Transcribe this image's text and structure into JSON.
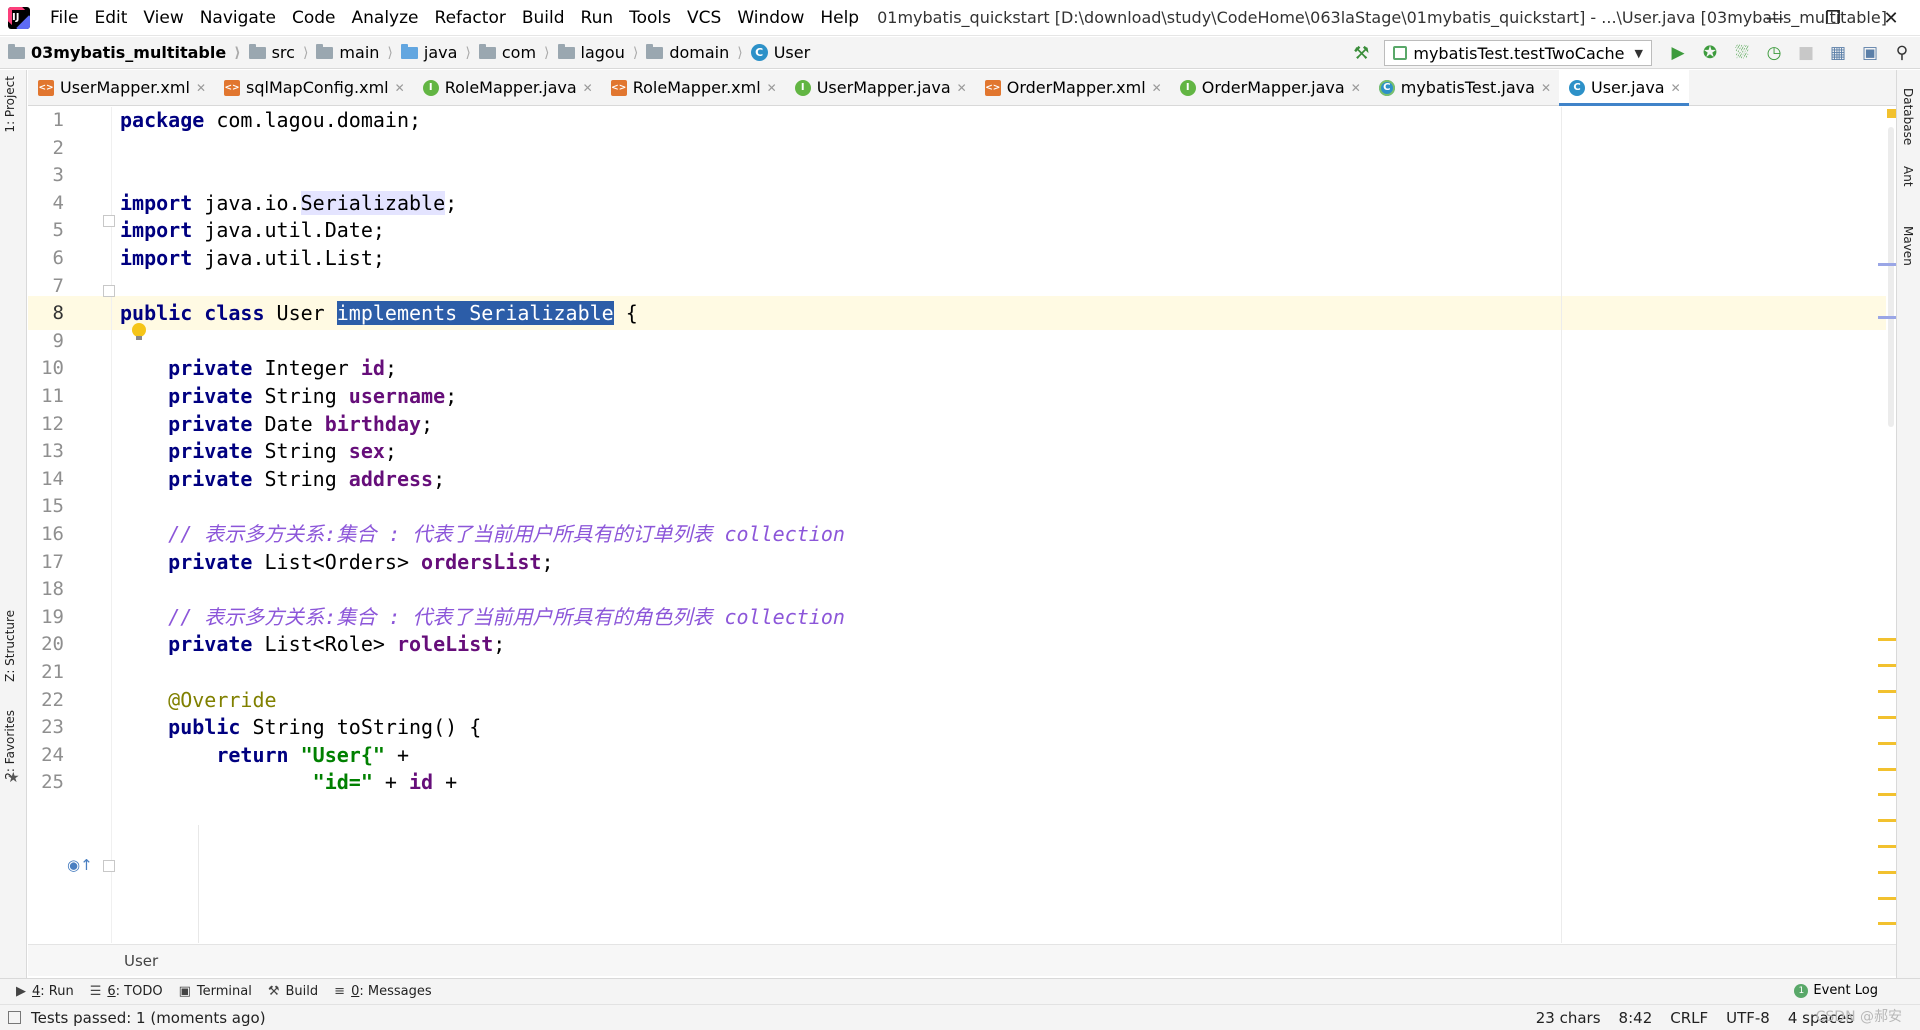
{
  "menubar": {
    "items": [
      "File",
      "Edit",
      "View",
      "Navigate",
      "Code",
      "Analyze",
      "Refactor",
      "Build",
      "Run",
      "Tools",
      "VCS",
      "Window",
      "Help"
    ],
    "window_title": "01mybatis_quickstart [D:\\download\\study\\CodeHome\\063laStage\\01mybatis_quickstart] - ...\\User.java [03mybatis_multitable]"
  },
  "navbar": {
    "project": "03mybatis_multitable",
    "crumbs": [
      "src",
      "main",
      "java",
      "com",
      "lagou",
      "domain",
      "User"
    ],
    "run_config": "mybatisTest.testTwoCache"
  },
  "left_tools": {
    "project": "1: Project",
    "structure": "Z: Structure",
    "favorites": "2: Favorites"
  },
  "right_tools": {
    "database": "Database",
    "ant": "Ant",
    "maven": "Maven"
  },
  "tabs": [
    {
      "label": "UserMapper.xml",
      "type": "xml"
    },
    {
      "label": "sqlMapConfig.xml",
      "type": "xml"
    },
    {
      "label": "RoleMapper.java",
      "type": "iface"
    },
    {
      "label": "RoleMapper.xml",
      "type": "xml"
    },
    {
      "label": "UserMapper.java",
      "type": "iface"
    },
    {
      "label": "OrderMapper.xml",
      "type": "xml"
    },
    {
      "label": "OrderMapper.java",
      "type": "iface"
    },
    {
      "label": "mybatisTest.java",
      "type": "test"
    },
    {
      "label": "User.java",
      "type": "cls",
      "active": true
    }
  ],
  "editor": {
    "current_line": 8,
    "lines": [
      {
        "n": "1",
        "code": [
          [
            "kw",
            "package"
          ],
          [
            "",
            " com.lagou.domain;"
          ]
        ]
      },
      {
        "n": "2",
        "code": []
      },
      {
        "n": "3",
        "code": []
      },
      {
        "n": "4",
        "code": [
          [
            "kw",
            "import"
          ],
          [
            "",
            " java.io."
          ],
          [
            "hl",
            "Serializable"
          ],
          [
            "",
            ";"
          ]
        ]
      },
      {
        "n": "5",
        "code": [
          [
            "kw",
            "import"
          ],
          [
            "",
            " java.util.Date;"
          ]
        ]
      },
      {
        "n": "6",
        "code": [
          [
            "kw",
            "import"
          ],
          [
            "",
            " java.util.List;"
          ]
        ]
      },
      {
        "n": "7",
        "code": []
      },
      {
        "n": "8",
        "code": [
          [
            "kw",
            "public class"
          ],
          [
            "",
            " User "
          ],
          [
            "sel",
            "implements Serializable"
          ],
          [
            "",
            " {"
          ]
        ]
      },
      {
        "n": "9",
        "code": []
      },
      {
        "n": "10",
        "code": [
          [
            "",
            "    "
          ],
          [
            "kw",
            "private"
          ],
          [
            "",
            " Integer "
          ],
          [
            "fld",
            "id"
          ],
          [
            "",
            ";"
          ]
        ]
      },
      {
        "n": "11",
        "code": [
          [
            "",
            "    "
          ],
          [
            "kw",
            "private"
          ],
          [
            "",
            " String "
          ],
          [
            "fld",
            "username"
          ],
          [
            "",
            ";"
          ]
        ]
      },
      {
        "n": "12",
        "code": [
          [
            "",
            "    "
          ],
          [
            "kw",
            "private"
          ],
          [
            "",
            " Date "
          ],
          [
            "fld",
            "birthday"
          ],
          [
            "",
            ";"
          ]
        ]
      },
      {
        "n": "13",
        "code": [
          [
            "",
            "    "
          ],
          [
            "kw",
            "private"
          ],
          [
            "",
            " String "
          ],
          [
            "fld",
            "sex"
          ],
          [
            "",
            ";"
          ]
        ]
      },
      {
        "n": "14",
        "code": [
          [
            "",
            "    "
          ],
          [
            "kw",
            "private"
          ],
          [
            "",
            " String "
          ],
          [
            "fld",
            "address"
          ],
          [
            "",
            ";"
          ]
        ]
      },
      {
        "n": "15",
        "code": []
      },
      {
        "n": "16",
        "code": [
          [
            "",
            "    "
          ],
          [
            "cmt",
            "// 表示多方关系:集合 : 代表了当前用户所具有的订单列表 collection"
          ]
        ]
      },
      {
        "n": "17",
        "code": [
          [
            "",
            "    "
          ],
          [
            "kw",
            "private"
          ],
          [
            "",
            " List<Orders> "
          ],
          [
            "fld",
            "ordersList"
          ],
          [
            "",
            ";"
          ]
        ]
      },
      {
        "n": "18",
        "code": []
      },
      {
        "n": "19",
        "code": [
          [
            "",
            "    "
          ],
          [
            "cmt",
            "// 表示多方关系:集合 : 代表了当前用户所具有的角色列表 collection"
          ]
        ]
      },
      {
        "n": "20",
        "code": [
          [
            "",
            "    "
          ],
          [
            "kw",
            "private"
          ],
          [
            "",
            " List<Role> "
          ],
          [
            "fld",
            "roleList"
          ],
          [
            "",
            ";"
          ]
        ]
      },
      {
        "n": "21",
        "code": []
      },
      {
        "n": "22",
        "code": [
          [
            "",
            "    "
          ],
          [
            "ann",
            "@Override"
          ]
        ]
      },
      {
        "n": "23",
        "code": [
          [
            "",
            "    "
          ],
          [
            "kw",
            "public"
          ],
          [
            "",
            " String toString() {"
          ]
        ]
      },
      {
        "n": "24",
        "code": [
          [
            "",
            "        "
          ],
          [
            "kw",
            "return"
          ],
          [
            "",
            " "
          ],
          [
            "str",
            "\"User{\""
          ],
          [
            "",
            " +"
          ]
        ]
      },
      {
        "n": "25",
        "code": [
          [
            "",
            "                "
          ],
          [
            "str",
            "\"id=\""
          ],
          [
            "",
            " + "
          ],
          [
            "fld",
            "id"
          ],
          [
            "",
            " +"
          ]
        ]
      }
    ],
    "breadcrumb": "User"
  },
  "tool_windows": [
    {
      "key": "4",
      "label": ": Run",
      "icon": "run-icon"
    },
    {
      "key": "6",
      "label": ": TODO",
      "icon": "todo-icon"
    },
    {
      "key": "",
      "label": "Terminal",
      "icon": "terminal-icon"
    },
    {
      "key": "",
      "label": "Build",
      "icon": "build-icon"
    },
    {
      "key": "0",
      "label": ": Messages",
      "icon": "messages-icon"
    }
  ],
  "event_log": "Event Log",
  "status": {
    "message": "Tests passed: 1 (moments ago)",
    "chars": "23 chars",
    "position": "8:42",
    "line_sep": "CRLF",
    "encoding": "UTF-8",
    "indent": "4 spaces"
  },
  "watermark": "CSDN @郝安"
}
